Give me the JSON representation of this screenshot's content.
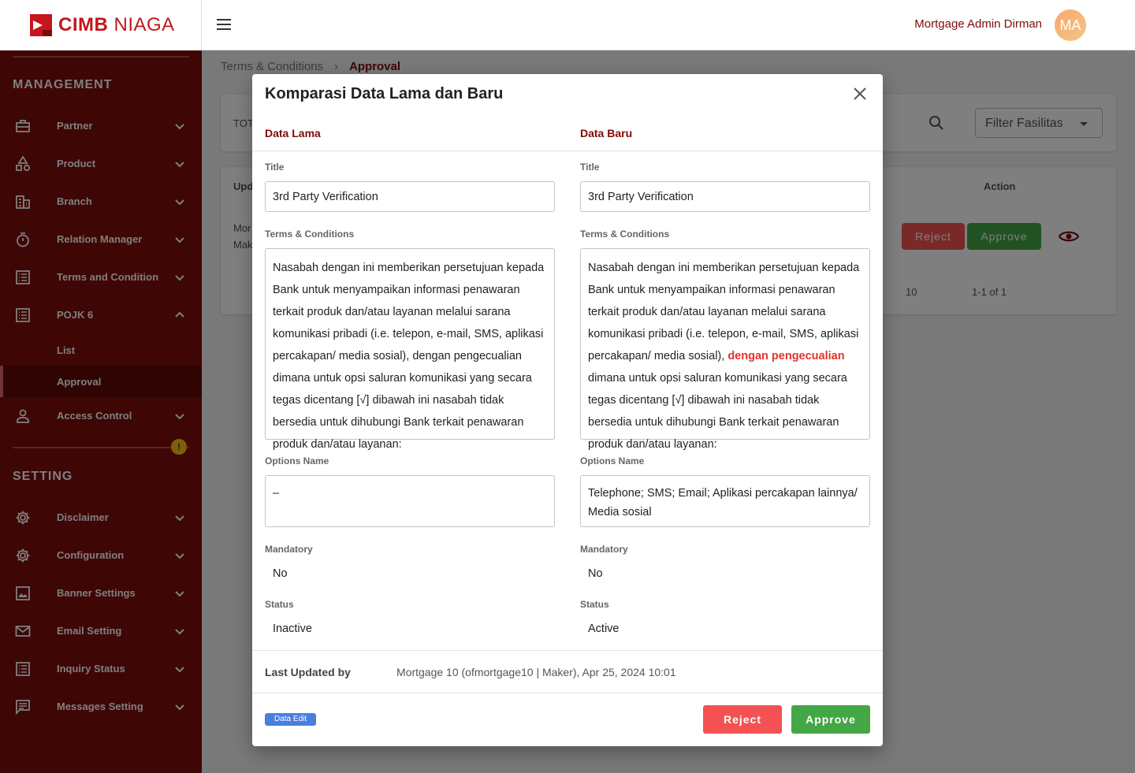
{
  "brand": {
    "name_bold": "CIMB",
    "name_light": " NIAGA"
  },
  "user": {
    "name": "Mortgage Admin Dirman",
    "initials": "MA"
  },
  "sidebar": {
    "management_title": "MANAGEMENT",
    "setting_title": "SETTING",
    "items": [
      {
        "label": "Partner",
        "icon": "briefcase-icon"
      },
      {
        "label": "Product",
        "icon": "shapes-icon"
      },
      {
        "label": "Branch",
        "icon": "building-icon"
      },
      {
        "label": "Relation Manager",
        "icon": "stopwatch-icon"
      },
      {
        "label": "Terms and Condition",
        "icon": "document-icon"
      },
      {
        "label": "POJK 6",
        "icon": "document-icon"
      },
      {
        "label": "Access Control",
        "icon": "person-icon"
      }
    ],
    "sub_items": [
      "List",
      "Approval"
    ],
    "setting_items": [
      {
        "label": "Disclaimer",
        "icon": "gear-icon"
      },
      {
        "label": "Configuration",
        "icon": "gear-icon"
      },
      {
        "label": "Banner Settings",
        "icon": "image-icon"
      },
      {
        "label": "Email Setting",
        "icon": "mail-icon"
      },
      {
        "label": "Inquiry Status",
        "icon": "document-icon"
      },
      {
        "label": "Messages Setting",
        "icon": "message-icon"
      }
    ],
    "warning_badge": "!"
  },
  "breadcrumb": {
    "parent": "Terms & Conditions",
    "sep": "›",
    "current": "Approval"
  },
  "background": {
    "total_label": "TOT",
    "filter_label": "Filter Fasilitas",
    "col_updated": "Upd",
    "col_action": "Action",
    "row_text_1": "Mor",
    "row_text_2": "Mak",
    "reject_label": "Reject",
    "approve_label": "Approve",
    "rows_per_page": "10",
    "page_range": "1-1 of 1"
  },
  "modal": {
    "title": "Komparasi Data Lama dan Baru",
    "old_head": "Data Lama",
    "new_head": "Data Baru",
    "title_label": "Title",
    "tnc_label": "Terms & Conditions",
    "options_label": "Options Name",
    "mandatory_label": "Mandatory",
    "status_label": "Status",
    "old": {
      "title": "3rd Party Verification",
      "tnc": "Nasabah dengan ini memberikan persetujuan kepada Bank untuk menyampaikan informasi penawaran terkait produk dan/atau layanan melalui sarana komunikasi pribadi (i.e. telepon, e-mail, SMS, aplikasi percakapan/ media sosial), dengan pengecualian dimana untuk opsi saluran komunikasi yang secara tegas dicentang [√] dibawah ini nasabah tidak bersedia untuk dihubungi Bank terkait penawaran produk dan/atau layanan:",
      "options": "–",
      "mandatory": "No",
      "status": "Inactive"
    },
    "new": {
      "title": "3rd Party Verification",
      "tnc_before": "Nasabah dengan ini memberikan persetujuan kepada Bank untuk menyampaikan informasi penawaran terkait produk dan/atau layanan melalui sarana komunikasi pribadi (i.e. telepon, e-mail, SMS, aplikasi percakapan/ media sosial), ",
      "tnc_highlight": "dengan pengecualian",
      "tnc_after": " dimana untuk opsi saluran komunikasi yang secara tegas dicentang [√] dibawah ini nasabah tidak bersedia untuk dihubungi Bank terkait penawaran produk dan/atau layanan:",
      "options": "Telephone; SMS; Email; Aplikasi percakapan lainnya/ Media sosial",
      "mandatory": "No",
      "status": "Active"
    },
    "last_updated_label": "Last Updated by",
    "last_updated_value": "Mortgage 10 (ofmortgage10 | Maker), Apr 25, 2024 10:01",
    "tag": "Data Edit",
    "reject_label": "Reject",
    "approve_label": "Approve"
  },
  "colors": {
    "primary": "#7d0c09",
    "reject": "#f45252",
    "approve": "#43a745",
    "highlight": "#e5322d",
    "tag": "#4a7de0"
  }
}
